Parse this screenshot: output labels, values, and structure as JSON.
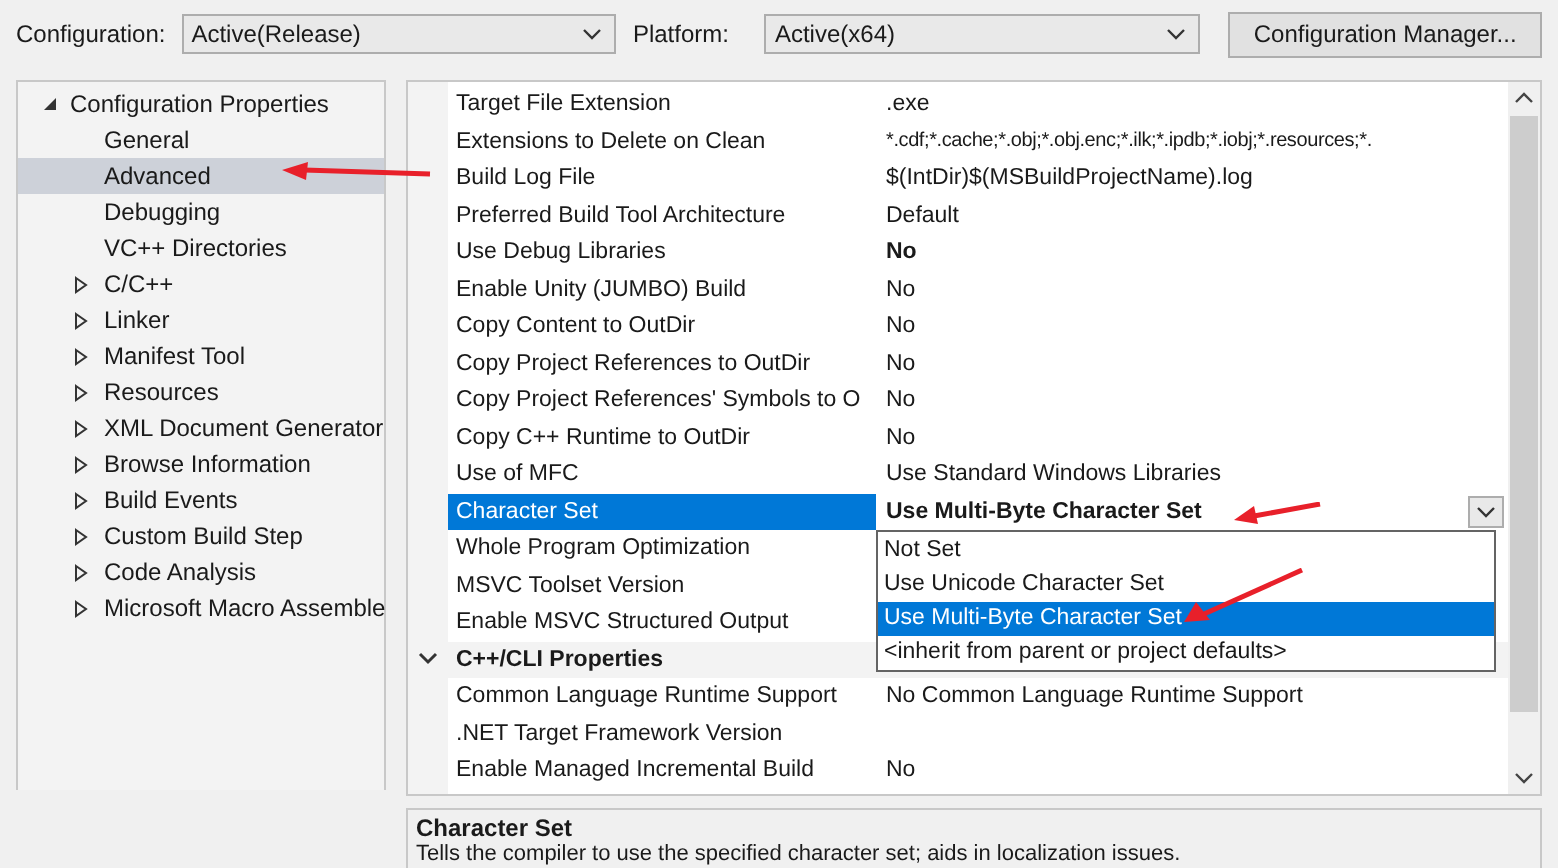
{
  "toolbar": {
    "configuration_label": "Configuration:",
    "configuration": "Active(Release)",
    "platform_label": "Platform:",
    "platform": "Active(x64)",
    "manager_button": "Configuration Manager..."
  },
  "tree": [
    {
      "label": "Configuration Properties",
      "expanded": true,
      "children": [
        {
          "label": "General",
          "selected": false,
          "has_children": false
        },
        {
          "label": "Advanced",
          "selected": true,
          "has_children": false
        },
        {
          "label": "Debugging",
          "selected": false,
          "has_children": false
        },
        {
          "label": "VC++ Directories",
          "selected": false,
          "has_children": false
        },
        {
          "label": "C/C++",
          "selected": false,
          "has_children": true
        },
        {
          "label": "Linker",
          "selected": false,
          "has_children": true
        },
        {
          "label": "Manifest Tool",
          "selected": false,
          "has_children": true
        },
        {
          "label": "Resources",
          "selected": false,
          "has_children": true
        },
        {
          "label": "XML Document Generator",
          "selected": false,
          "has_children": true
        },
        {
          "label": "Browse Information",
          "selected": false,
          "has_children": true
        },
        {
          "label": "Build Events",
          "selected": false,
          "has_children": true
        },
        {
          "label": "Custom Build Step",
          "selected": false,
          "has_children": true
        },
        {
          "label": "Code Analysis",
          "selected": false,
          "has_children": true
        },
        {
          "label": "Microsoft Macro Assemble",
          "selected": false,
          "has_children": true
        }
      ]
    }
  ],
  "grid": [
    {
      "kind": "property",
      "name": "Target File Extension",
      "value": ".exe",
      "modified": false,
      "selected": false
    },
    {
      "kind": "property",
      "name": "Extensions to Delete on Clean",
      "value": "*.cdf;*.cache;*.obj;*.obj.enc;*.ilk;*.ipdb;*.iobj;*.resources;*.",
      "modified": false,
      "selected": false
    },
    {
      "kind": "property",
      "name": "Build Log File",
      "value": "$(IntDir)$(MSBuildProjectName).log",
      "modified": false,
      "selected": false
    },
    {
      "kind": "property",
      "name": "Preferred Build Tool Architecture",
      "value": "Default",
      "modified": false,
      "selected": false
    },
    {
      "kind": "property",
      "name": "Use Debug Libraries",
      "value": "No",
      "modified": true,
      "selected": false
    },
    {
      "kind": "property",
      "name": "Enable Unity (JUMBO) Build",
      "value": "No",
      "modified": false,
      "selected": false
    },
    {
      "kind": "property",
      "name": "Copy Content to OutDir",
      "value": "No",
      "modified": false,
      "selected": false
    },
    {
      "kind": "property",
      "name": "Copy Project References to OutDir",
      "value": "No",
      "modified": false,
      "selected": false
    },
    {
      "kind": "property",
      "name": "Copy Project References' Symbols to O",
      "value": "No",
      "modified": false,
      "selected": false
    },
    {
      "kind": "property",
      "name": "Copy C++ Runtime to OutDir",
      "value": "No",
      "modified": false,
      "selected": false
    },
    {
      "kind": "property",
      "name": "Use of MFC",
      "value": "Use Standard Windows Libraries",
      "modified": false,
      "selected": false
    },
    {
      "kind": "property",
      "name": "Character Set",
      "value": "Use Multi-Byte Character Set",
      "modified": true,
      "selected": true
    },
    {
      "kind": "property",
      "name": "Whole Program Optimization",
      "selected": false
    },
    {
      "kind": "property",
      "name": "MSVC Toolset Version",
      "selected": false
    },
    {
      "kind": "property",
      "name": "Enable MSVC Structured Output",
      "selected": false
    },
    {
      "kind": "category",
      "name": "C++/CLI Properties",
      "expanded": true
    },
    {
      "kind": "property",
      "name": "Common Language Runtime Support",
      "value": "No Common Language Runtime Support",
      "modified": false,
      "selected": false
    },
    {
      "kind": "property",
      "name": ".NET Target Framework Version",
      "selected": false
    },
    {
      "kind": "property",
      "name": "Enable Managed Incremental Build",
      "value": "No",
      "modified": false,
      "selected": false
    }
  ],
  "dropdown": {
    "options": [
      {
        "label": "Not Set",
        "selected": false
      },
      {
        "label": "Use Unicode Character Set",
        "selected": false
      },
      {
        "label": "Use Multi-Byte Character Set",
        "selected": true
      },
      {
        "label": "<inherit from parent or project defaults>",
        "selected": false
      }
    ]
  },
  "description": {
    "title": "Character Set",
    "text": "Tells the compiler to use the specified character set; aids in localization issues."
  }
}
